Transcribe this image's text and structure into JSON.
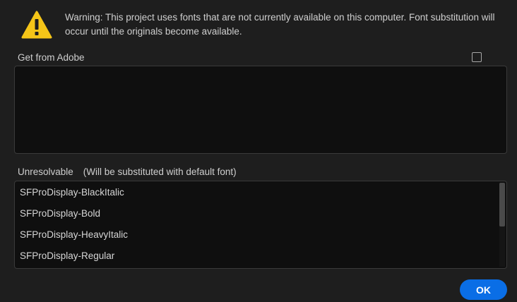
{
  "warning": {
    "icon": "warning-triangle-icon",
    "icon_color": "#f5c518",
    "text": "Warning: This project uses fonts that are not currently available on this computer. Font substitution will occur until the originals become available."
  },
  "get_from_adobe": {
    "label": "Get from Adobe",
    "checked": false
  },
  "unresolvable": {
    "label": "Unresolvable",
    "note": "(Will be substituted with default font)",
    "fonts": [
      "SFProDisplay-BlackItalic",
      "SFProDisplay-Bold",
      "SFProDisplay-HeavyItalic",
      "SFProDisplay-Regular"
    ]
  },
  "ok_button": {
    "label": "OK",
    "color": "#0a6ee6"
  }
}
